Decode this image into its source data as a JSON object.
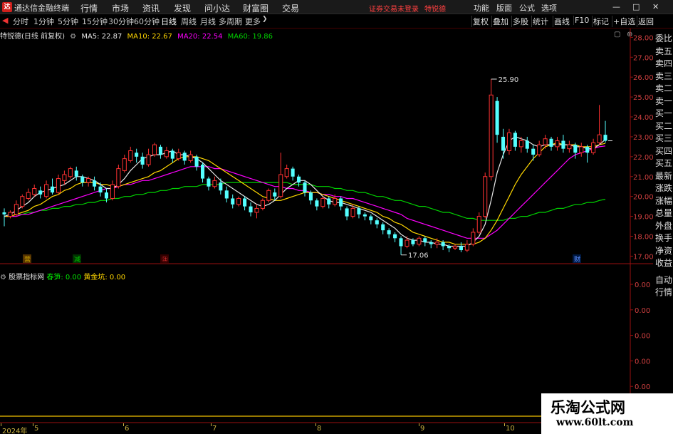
{
  "app": {
    "logo": "达",
    "title": "通达信金融终端"
  },
  "main_menu": [
    "行情",
    "市场",
    "资讯",
    "发现",
    "问小达",
    "财富圈",
    "交易"
  ],
  "login_status": "证券交易未登录",
  "stock_label": "特锐德",
  "right_menu": [
    "功能",
    "版面",
    "公式",
    "选项"
  ],
  "window_controls": [
    "—",
    "□",
    "✕"
  ],
  "period_tabs": [
    "分时",
    "1分钟",
    "5分钟",
    "15分钟",
    "30分钟",
    "60分钟",
    "日线",
    "周线",
    "月线",
    "多周期",
    "更多"
  ],
  "active_period": "日线",
  "chart_tools": [
    "复权",
    "叠加",
    "多股",
    "统计",
    "画线",
    "F10",
    "标记",
    "+自选",
    "返回"
  ],
  "price_legend": {
    "title": "特锐德(日线 前复权)",
    "ma5": "MA5: 22.87",
    "ma10": "MA10: 22.67",
    "ma20": "MA20: 22.54",
    "ma60": "MA60: 19.86"
  },
  "indicator_legend": {
    "name": "股票指标网",
    "a": "春笋: 0.00",
    "b": "黄金坑: 0.00"
  },
  "sidebar": [
    "委比",
    "卖五",
    "卖四",
    "卖三",
    "卖二",
    "卖一",
    "买一",
    "买二",
    "买三",
    "买四",
    "买五",
    "最新",
    "涨跌",
    "涨幅",
    "总量",
    "外盘",
    "换手",
    "净资",
    "收益"
  ],
  "sidebar_bottom": [
    "自动",
    "行情"
  ],
  "watermark": {
    "line1": "乐淘公式网",
    "line2": "www.60lt.com"
  },
  "colors": {
    "up": "#ff3232",
    "down": "#54ffff",
    "ma5": "#e8e8e8",
    "ma10": "#ffd700",
    "ma20": "#ff00ff",
    "ma60": "#00d000",
    "axis": "#9a1010"
  },
  "chart_data": {
    "type": "candlestick",
    "price_axis": {
      "ticks": [
        28.0,
        27.0,
        26.0,
        25.0,
        24.0,
        23.0,
        22.0,
        21.0,
        20.0,
        19.0,
        18.0,
        17.0
      ],
      "range": [
        16.8,
        28.3
      ]
    },
    "indicator_axis": {
      "ticks": [
        "0.00",
        "0.00",
        "0.00",
        "0.00",
        "0.00",
        "0.00"
      ]
    },
    "annotations": {
      "high": "25.90",
      "low": "17.06"
    },
    "event_marks": [
      "营",
      "减",
      "㊟",
      "财"
    ],
    "x_labels": [
      "2024年",
      "5",
      "6",
      "7",
      "8",
      "9",
      "10"
    ],
    "candles": [
      [
        19.2,
        19.1,
        18.5,
        19.4
      ],
      [
        19.0,
        19.2,
        18.9,
        19.3
      ],
      [
        19.1,
        19.6,
        19.0,
        19.8
      ],
      [
        19.5,
        20.0,
        19.4,
        20.1
      ],
      [
        19.9,
        20.2,
        19.8,
        20.4
      ],
      [
        20.1,
        20.4,
        20.0,
        20.6
      ],
      [
        20.3,
        20.1,
        19.9,
        20.5
      ],
      [
        20.0,
        20.6,
        19.9,
        20.8
      ],
      [
        20.5,
        20.2,
        20.1,
        20.9
      ],
      [
        20.2,
        20.9,
        20.1,
        21.1
      ],
      [
        20.8,
        21.1,
        20.6,
        21.3
      ],
      [
        21.0,
        21.4,
        20.9,
        21.5
      ],
      [
        21.3,
        21.0,
        20.8,
        21.5
      ],
      [
        21.0,
        20.7,
        20.5,
        21.1
      ],
      [
        20.7,
        20.9,
        20.5,
        21.0
      ],
      [
        20.8,
        20.5,
        20.3,
        21.0
      ],
      [
        20.5,
        20.2,
        20.0,
        20.7
      ],
      [
        20.2,
        19.9,
        19.7,
        20.4
      ],
      [
        19.9,
        20.6,
        19.8,
        20.8
      ],
      [
        20.5,
        21.4,
        20.4,
        21.6
      ],
      [
        21.3,
        21.9,
        21.2,
        22.1
      ],
      [
        21.8,
        22.3,
        21.7,
        22.5
      ],
      [
        22.2,
        22.0,
        21.7,
        22.4
      ],
      [
        22.0,
        21.6,
        21.4,
        22.2
      ],
      [
        21.6,
        22.1,
        21.5,
        22.4
      ],
      [
        22.1,
        22.6,
        22.0,
        22.7
      ],
      [
        22.5,
        22.1,
        21.9,
        22.6
      ],
      [
        22.0,
        22.3,
        21.9,
        22.5
      ],
      [
        22.3,
        21.9,
        21.7,
        22.4
      ],
      [
        21.9,
        22.2,
        21.8,
        22.4
      ],
      [
        22.2,
        21.8,
        21.6,
        22.3
      ],
      [
        21.8,
        22.1,
        21.7,
        22.3
      ],
      [
        22.0,
        21.5,
        21.3,
        22.1
      ],
      [
        21.6,
        20.9,
        20.7,
        21.7
      ],
      [
        20.9,
        20.5,
        20.3,
        21.0
      ],
      [
        20.5,
        20.8,
        20.4,
        21.0
      ],
      [
        20.7,
        20.3,
        20.1,
        20.9
      ],
      [
        20.3,
        19.9,
        19.7,
        20.5
      ],
      [
        19.9,
        19.6,
        19.4,
        20.1
      ],
      [
        19.6,
        19.9,
        19.5,
        20.0
      ],
      [
        19.9,
        19.5,
        19.3,
        20.0
      ],
      [
        19.5,
        19.2,
        19.0,
        19.7
      ],
      [
        19.2,
        19.4,
        18.9,
        19.6
      ],
      [
        19.4,
        19.8,
        19.3,
        19.9
      ],
      [
        19.8,
        20.3,
        19.7,
        20.4
      ],
      [
        20.2,
        20.0,
        19.8,
        20.4
      ],
      [
        20.0,
        21.1,
        19.9,
        22.2
      ],
      [
        21.0,
        21.4,
        20.9,
        21.6
      ],
      [
        21.4,
        21.0,
        20.8,
        21.5
      ],
      [
        21.0,
        20.7,
        20.5,
        21.1
      ],
      [
        20.7,
        20.2,
        20.0,
        20.8
      ],
      [
        20.2,
        19.8,
        19.6,
        20.3
      ],
      [
        19.8,
        19.5,
        19.3,
        19.9
      ],
      [
        19.5,
        19.9,
        19.4,
        20.0
      ],
      [
        19.9,
        19.6,
        19.4,
        20.0
      ],
      [
        19.6,
        19.9,
        19.5,
        20.1
      ],
      [
        19.9,
        19.5,
        19.3,
        20.0
      ],
      [
        19.4,
        19.0,
        18.8,
        19.5
      ],
      [
        19.0,
        19.4,
        18.9,
        19.6
      ],
      [
        19.4,
        19.1,
        18.9,
        19.5
      ],
      [
        19.1,
        19.0,
        18.8,
        19.2
      ],
      [
        19.0,
        18.8,
        18.6,
        19.1
      ],
      [
        18.8,
        18.6,
        18.4,
        18.9
      ],
      [
        18.6,
        18.3,
        18.1,
        18.7
      ],
      [
        18.3,
        18.1,
        17.9,
        18.4
      ],
      [
        18.1,
        17.9,
        17.7,
        18.2
      ],
      [
        17.9,
        17.5,
        17.06,
        18.0
      ],
      [
        17.5,
        17.8,
        17.4,
        18.0
      ],
      [
        17.8,
        17.6,
        17.5,
        17.9
      ],
      [
        17.6,
        17.9,
        17.5,
        18.0
      ],
      [
        17.9,
        17.7,
        17.5,
        18.0
      ],
      [
        17.7,
        17.6,
        17.4,
        17.8
      ],
      [
        17.6,
        17.7,
        17.4,
        17.9
      ],
      [
        17.7,
        17.5,
        17.3,
        17.8
      ],
      [
        17.5,
        17.4,
        17.2,
        17.6
      ],
      [
        17.4,
        17.5,
        17.3,
        17.6
      ],
      [
        17.5,
        17.3,
        17.2,
        17.7
      ],
      [
        17.3,
        17.6,
        17.2,
        17.8
      ],
      [
        17.6,
        18.2,
        17.5,
        18.4
      ],
      [
        18.2,
        19.0,
        18.1,
        19.2
      ],
      [
        19.0,
        21.0,
        18.9,
        21.2
      ],
      [
        21.0,
        25.1,
        20.8,
        25.9
      ],
      [
        24.8,
        23.1,
        22.7,
        25.0
      ],
      [
        23.0,
        22.3,
        21.9,
        23.4
      ],
      [
        22.3,
        23.2,
        22.1,
        23.4
      ],
      [
        23.2,
        22.5,
        22.3,
        23.3
      ],
      [
        22.5,
        22.8,
        22.2,
        23.0
      ],
      [
        22.8,
        22.4,
        22.2,
        23.0
      ],
      [
        22.4,
        22.1,
        21.8,
        22.6
      ],
      [
        22.1,
        22.6,
        22.0,
        22.8
      ],
      [
        22.6,
        22.9,
        22.4,
        23.1
      ],
      [
        22.9,
        22.5,
        22.3,
        23.0
      ],
      [
        22.5,
        22.8,
        22.3,
        23.0
      ],
      [
        22.8,
        22.4,
        22.2,
        23.1
      ],
      [
        22.4,
        22.6,
        22.2,
        22.8
      ],
      [
        22.6,
        22.2,
        21.9,
        22.7
      ],
      [
        22.2,
        22.5,
        22.0,
        22.7
      ],
      [
        22.5,
        22.2,
        21.7,
        22.6
      ],
      [
        22.2,
        22.7,
        22.1,
        22.9
      ],
      [
        22.7,
        23.1,
        22.6,
        24.6
      ],
      [
        23.1,
        22.8,
        22.7,
        23.8
      ]
    ],
    "ma5": [
      19.0,
      19.1,
      19.3,
      19.5,
      19.7,
      20.0,
      20.2,
      20.3,
      20.4,
      20.5,
      20.6,
      20.8,
      21.0,
      21.0,
      20.9,
      20.8,
      20.6,
      20.4,
      20.4,
      20.6,
      20.9,
      21.3,
      21.6,
      21.9,
      22.0,
      22.1,
      22.1,
      22.2,
      22.3,
      22.1,
      22.1,
      22.0,
      21.9,
      21.7,
      21.4,
      21.1,
      20.8,
      20.6,
      20.4,
      20.2,
      20.0,
      19.8,
      19.6,
      19.5,
      19.6,
      19.8,
      20.1,
      20.4,
      20.6,
      20.8,
      20.8,
      20.6,
      20.3,
      20.0,
      19.8,
      19.7,
      19.7,
      19.6,
      19.5,
      19.4,
      19.3,
      19.2,
      19.0,
      18.8,
      18.6,
      18.4,
      18.1,
      17.9,
      17.8,
      17.8,
      17.7,
      17.7,
      17.6,
      17.6,
      17.5,
      17.5,
      17.5,
      17.5,
      17.7,
      18.0,
      18.6,
      19.8,
      21.2,
      22.1,
      22.8,
      23.0,
      22.9,
      22.8,
      22.6,
      22.5,
      22.6,
      22.6,
      22.6,
      22.6,
      22.6,
      22.5,
      22.5,
      22.4,
      22.4,
      22.6,
      22.87
    ],
    "ma10": [
      19.0,
      19.0,
      19.1,
      19.2,
      19.3,
      19.5,
      19.6,
      19.8,
      20.0,
      20.1,
      20.3,
      20.4,
      20.6,
      20.7,
      20.7,
      20.7,
      20.6,
      20.6,
      20.5,
      20.5,
      20.6,
      20.7,
      20.8,
      20.9,
      21.0,
      21.2,
      21.3,
      21.5,
      21.7,
      21.9,
      22.0,
      22.0,
      22.0,
      21.9,
      21.8,
      21.6,
      21.4,
      21.2,
      21.0,
      20.8,
      20.6,
      20.4,
      20.2,
      20.0,
      19.9,
      19.8,
      19.8,
      19.9,
      20.0,
      20.1,
      20.2,
      20.2,
      20.2,
      20.1,
      20.0,
      19.9,
      19.8,
      19.7,
      19.6,
      19.5,
      19.4,
      19.3,
      19.2,
      19.0,
      18.9,
      18.7,
      18.6,
      18.4,
      18.2,
      18.1,
      18.0,
      17.9,
      17.8,
      17.7,
      17.7,
      17.6,
      17.6,
      17.6,
      17.6,
      17.7,
      17.9,
      18.3,
      18.8,
      19.4,
      20.0,
      20.6,
      21.1,
      21.5,
      21.9,
      22.2,
      22.5,
      22.6,
      22.7,
      22.6,
      22.6,
      22.6,
      22.5,
      22.5,
      22.5,
      22.6,
      22.67
    ],
    "ma20": [
      19.0,
      19.0,
      19.0,
      19.1,
      19.1,
      19.2,
      19.3,
      19.4,
      19.5,
      19.6,
      19.7,
      19.8,
      19.9,
      20.0,
      20.1,
      20.2,
      20.3,
      20.4,
      20.4,
      20.5,
      20.6,
      20.6,
      20.7,
      20.8,
      20.8,
      20.9,
      21.0,
      21.1,
      21.2,
      21.3,
      21.4,
      21.5,
      21.5,
      21.5,
      21.5,
      21.4,
      21.4,
      21.3,
      21.2,
      21.1,
      21.0,
      20.9,
      20.8,
      20.7,
      20.6,
      20.5,
      20.5,
      20.4,
      20.4,
      20.3,
      20.3,
      20.2,
      20.2,
      20.1,
      20.1,
      20.0,
      20.0,
      19.9,
      19.9,
      19.8,
      19.7,
      19.6,
      19.5,
      19.4,
      19.3,
      19.2,
      19.1,
      18.9,
      18.8,
      18.7,
      18.6,
      18.5,
      18.4,
      18.3,
      18.2,
      18.1,
      18.0,
      17.9,
      17.9,
      17.9,
      17.9,
      18.1,
      18.3,
      18.6,
      18.9,
      19.2,
      19.5,
      19.8,
      20.1,
      20.4,
      20.7,
      21.0,
      21.3,
      21.6,
      21.9,
      22.1,
      22.2,
      22.3,
      22.4,
      22.5,
      22.54
    ],
    "ma60": [
      19.0,
      19.0,
      19.1,
      19.1,
      19.2,
      19.2,
      19.3,
      19.3,
      19.4,
      19.4,
      19.5,
      19.5,
      19.6,
      19.6,
      19.7,
      19.7,
      19.8,
      19.8,
      19.9,
      19.9,
      20.0,
      20.0,
      20.1,
      20.1,
      20.2,
      20.2,
      20.3,
      20.3,
      20.4,
      20.4,
      20.5,
      20.5,
      20.5,
      20.6,
      20.6,
      20.6,
      20.6,
      20.7,
      20.7,
      20.7,
      20.7,
      20.7,
      20.7,
      20.7,
      20.7,
      20.7,
      20.7,
      20.7,
      20.6,
      20.6,
      20.6,
      20.6,
      20.5,
      20.5,
      20.5,
      20.4,
      20.4,
      20.3,
      20.3,
      20.2,
      20.2,
      20.1,
      20.0,
      20.0,
      19.9,
      19.8,
      19.8,
      19.7,
      19.6,
      19.5,
      19.5,
      19.4,
      19.3,
      19.2,
      19.2,
      19.1,
      19.0,
      18.9,
      18.9,
      18.8,
      18.8,
      18.8,
      18.8,
      18.8,
      18.9,
      18.9,
      19.0,
      19.0,
      19.1,
      19.2,
      19.2,
      19.3,
      19.4,
      19.4,
      19.5,
      19.6,
      19.6,
      19.7,
      19.7,
      19.8,
      19.86
    ]
  }
}
